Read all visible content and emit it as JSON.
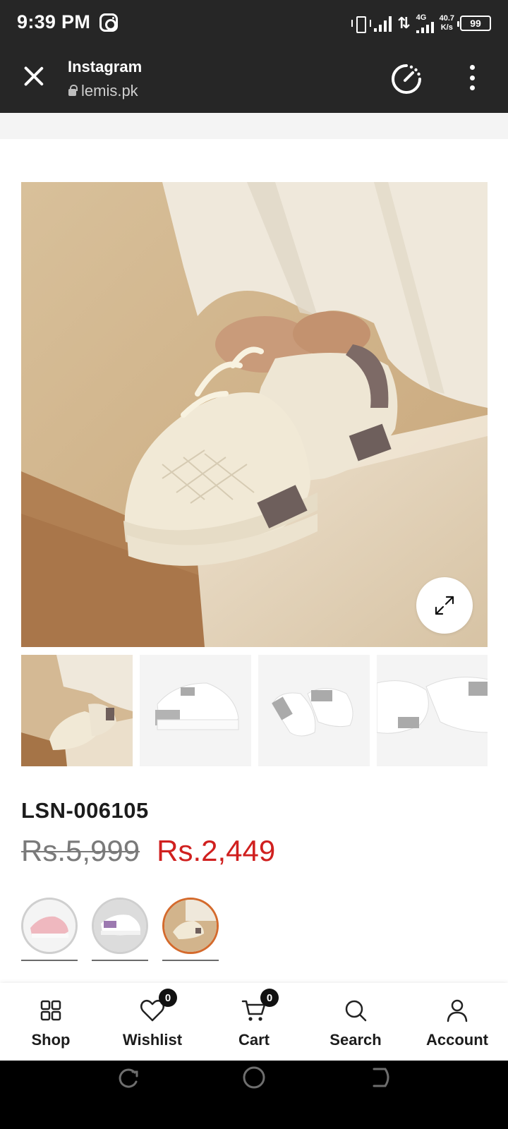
{
  "status_bar": {
    "time": "9:39 PM",
    "network": "4G",
    "speed_value": "40.7",
    "speed_unit": "K/s",
    "battery": "99"
  },
  "browser": {
    "title": "Instagram",
    "url": "lemis.pk"
  },
  "product": {
    "sku": "LSN-006105",
    "old_price": "Rs.5,999",
    "new_price": "Rs.2,449",
    "price_color": "#d0201f"
  },
  "bottom_nav": {
    "shop": "Shop",
    "wishlist": "Wishlist",
    "wishlist_count": "0",
    "cart": "Cart",
    "cart_count": "0",
    "search": "Search",
    "account": "Account"
  }
}
